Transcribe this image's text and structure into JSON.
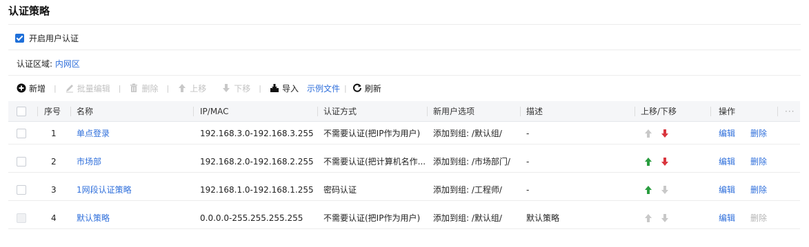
{
  "page": {
    "title": "认证策略"
  },
  "enable_auth": {
    "label": "开启用户认证",
    "checked": true
  },
  "zone": {
    "label": "认证区域:",
    "value": "内网区"
  },
  "toolbar": {
    "add": "新增",
    "batch_edit": "批量编辑",
    "delete": "删除",
    "move_up": "上移",
    "move_down": "下移",
    "import": "导入",
    "example_file": "示例文件",
    "refresh": "刷新"
  },
  "table": {
    "columns": {
      "seq": "序号",
      "name": "名称",
      "ipmac": "IP/MAC",
      "auth_method": "认证方式",
      "new_user_option": "新用户选项",
      "description": "描述",
      "move": "上移/下移",
      "ops": "操作",
      "more": "···"
    },
    "actions": {
      "edit": "编辑",
      "delete": "删除"
    },
    "rows": [
      {
        "seq": "1",
        "name": "单点登录",
        "ipmac": "192.168.3.0-192.168.3.255",
        "auth_method": "不需要认证(把IP作为用户)",
        "new_user_option": "添加到组: /默认组/",
        "description": "-"
      },
      {
        "seq": "2",
        "name": "市场部",
        "ipmac": "192.168.2.0-192.168.2.255",
        "auth_method": "不需要认证(把计算机名作...",
        "new_user_option": "添加到组: /市场部门/",
        "description": "-"
      },
      {
        "seq": "3",
        "name": "1网段认证策略",
        "ipmac": "192.168.1.0-192.168.1.255",
        "auth_method": "密码认证",
        "new_user_option": "添加到组: /工程师/",
        "description": "-"
      },
      {
        "seq": "4",
        "name": "默认策略",
        "ipmac": "0.0.0.0-255.255.255.255",
        "auth_method": "不需要认证(把IP作为用户)",
        "new_user_option": "添加到组: /默认组/",
        "description": "默认策略"
      }
    ]
  },
  "colors": {
    "link": "#2f6fdb",
    "up_active": "#2a9d3f",
    "down_active": "#d9363e",
    "disabled": "#c8c8c8",
    "checkbox": "#1e6fd9"
  }
}
